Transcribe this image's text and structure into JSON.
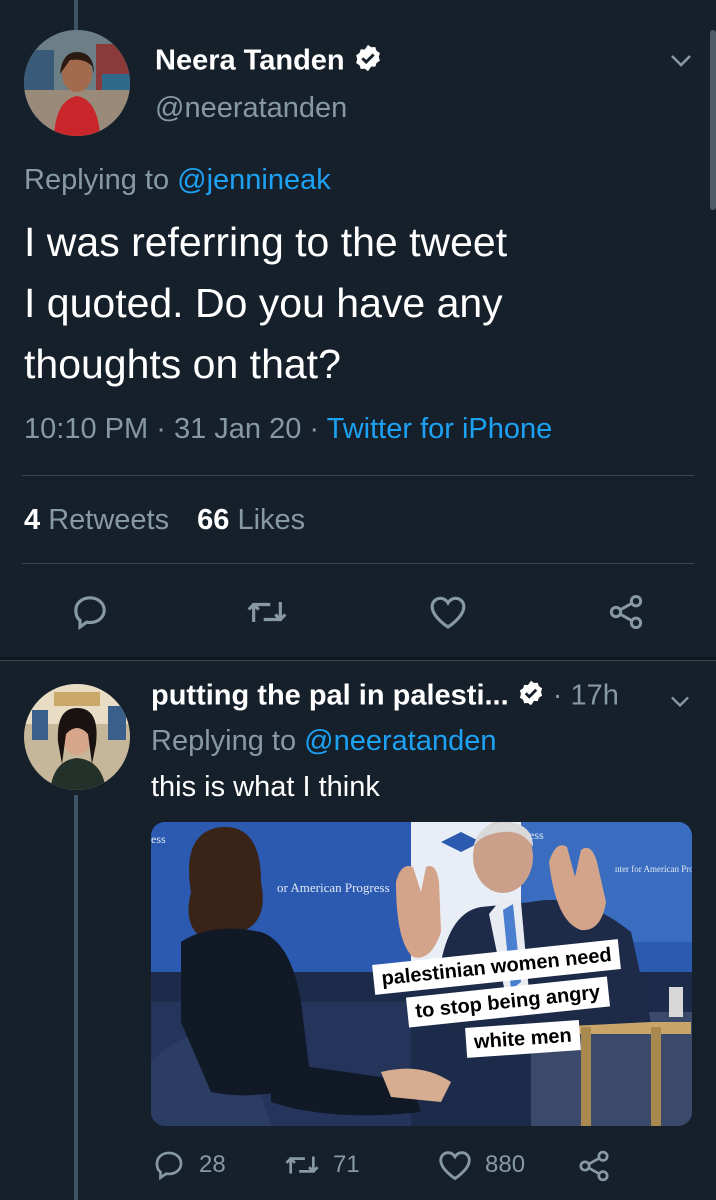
{
  "main_tweet": {
    "author_name": "Neera Tanden",
    "handle": "@neeratanden",
    "replying_prefix": "Replying to",
    "replying_to": "@jennineak",
    "text_line1": "I was referring to the tweet",
    "text_line2": "I quoted.  Do you have any",
    "text_line3": "thoughts on that?",
    "time": "10:10 PM",
    "date": "31 Jan 20",
    "separator": "·",
    "source": "Twitter for iPhone",
    "retweets_count": "4",
    "retweets_label": "Retweets",
    "likes_count": "66",
    "likes_label": "Likes"
  },
  "reply_tweet": {
    "author_name": "putting the pal in palesti...",
    "time_ago": "17h",
    "separator": "·",
    "replying_prefix": "Replying to",
    "replying_to": "@neeratanden",
    "text": "this is what I think",
    "image": {
      "banner_left": "or American Progress",
      "banner_top_left": "ess",
      "banner_top_right": "ess",
      "banner_right": "nter for American Prog",
      "caption_line1": "palestinian women need",
      "caption_line2": "to stop being angry",
      "caption_line3": "white men"
    },
    "replies_count": "28",
    "retweets_count": "71",
    "likes_count": "880"
  },
  "colors": {
    "background": "#15202b",
    "link": "#1da1f2",
    "muted": "#8899a6",
    "divider": "#38444d"
  }
}
